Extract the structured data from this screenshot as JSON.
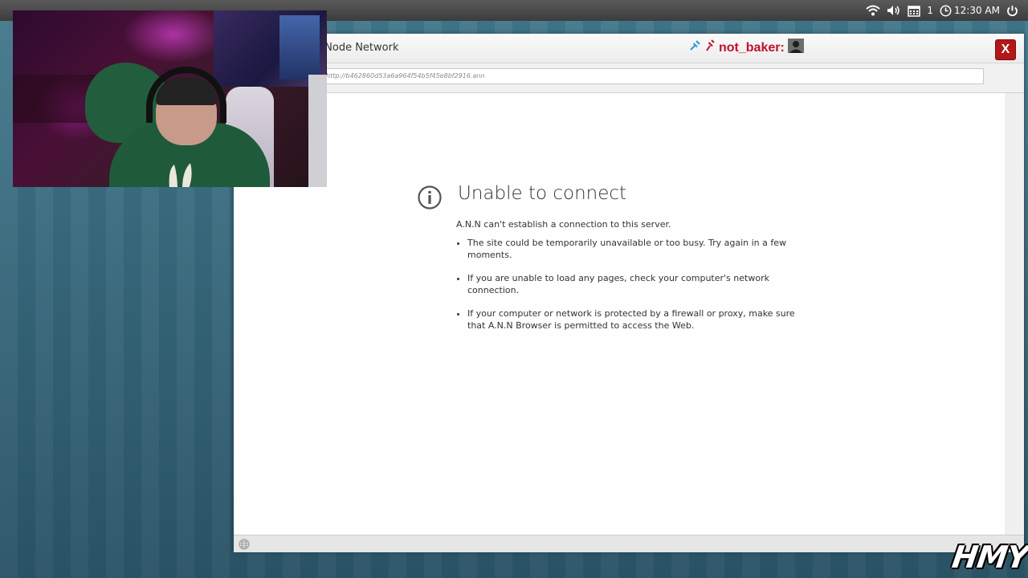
{
  "system_tray": {
    "notification_count": "1",
    "clock": "12:30 AM",
    "icons": [
      "wifi-icon",
      "volume-icon",
      "calendar-icon",
      "clock-icon",
      "power-icon"
    ]
  },
  "window": {
    "title": "us Node Network",
    "user": {
      "name": "not_baker:",
      "icons": [
        "pin-icon",
        "pin-icon",
        "avatar"
      ]
    },
    "close_label": "X",
    "address": "http://b462860d53a6a964f54b5f45e8bf2916.ann"
  },
  "error_page": {
    "title": "Unable to connect",
    "description": "A.N.N can't establish a connection to this server.",
    "items": [
      "The site could be temporarily unavailable or too busy. Try again in a few moments.",
      "If you are unable to load any pages, check your computer's network connection.",
      "If your computer or network is protected by a firewall or proxy, make sure that A.N.N Browser is permitted to access the Web."
    ]
  },
  "status_bar": {
    "icon": "globe-icon"
  },
  "watermark": "HMY",
  "colors": {
    "close_button": "#b31717",
    "username": "#c0102e",
    "desktop_stripe_light": "#4b7e92",
    "desktop_stripe_dark": "#3f7488"
  }
}
